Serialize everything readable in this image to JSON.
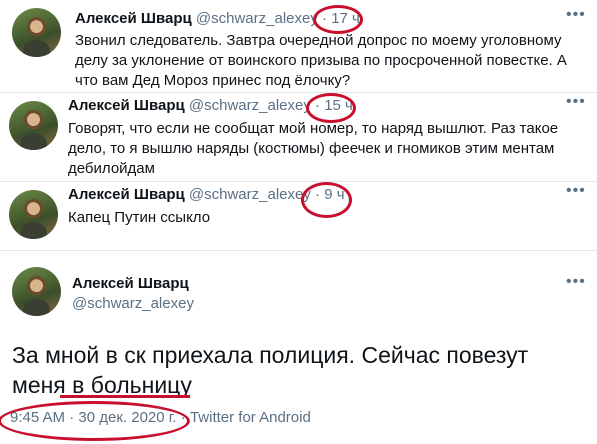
{
  "tweets": [
    {
      "name": "Алексей Шварц",
      "handle": "@schwarz_alexey",
      "separator": "·",
      "time": "17 ч",
      "text": "Звонил следователь. Завтра очередной допрос по моему уголовному делу за уклонение от воинского призыва по просроченной повестке. А что вам Дед Мороз принес под ёлочку?"
    },
    {
      "name": "Алексей Шварц",
      "handle": "@schwarz_alexey",
      "separator": "·",
      "time": "15 ч",
      "text": "Говорят, что если не сообщат мой номер, то наряд вышлют. Раз такое дело, то я вышлю наряды (костюмы) феечек и гномиков этим ментам дебилойдам"
    },
    {
      "name": "Алексей Шварц",
      "handle": "@schwarz_alexey",
      "separator": "·",
      "time": "9 ч",
      "text": "Капец Путин ссыкло"
    }
  ],
  "main_tweet": {
    "name": "Алексей Шварц",
    "handle": "@schwarz_alexey",
    "text_line1": "За мной в ск приехала полиция. Сейчас повезут",
    "text_line2_a": "меня ",
    "text_line2_b": "в больницу",
    "time": "9:45 AM",
    "separator": "·",
    "date": "30 дек. 2020 г.",
    "app_separator": "·",
    "app": "Twitter for Android"
  },
  "icons": {
    "more": "more-dots-icon",
    "avatar": "avatar"
  },
  "colors": {
    "accent_marker": "#c8102e",
    "muted": "#5b7083",
    "divider": "#e1e8ed"
  }
}
